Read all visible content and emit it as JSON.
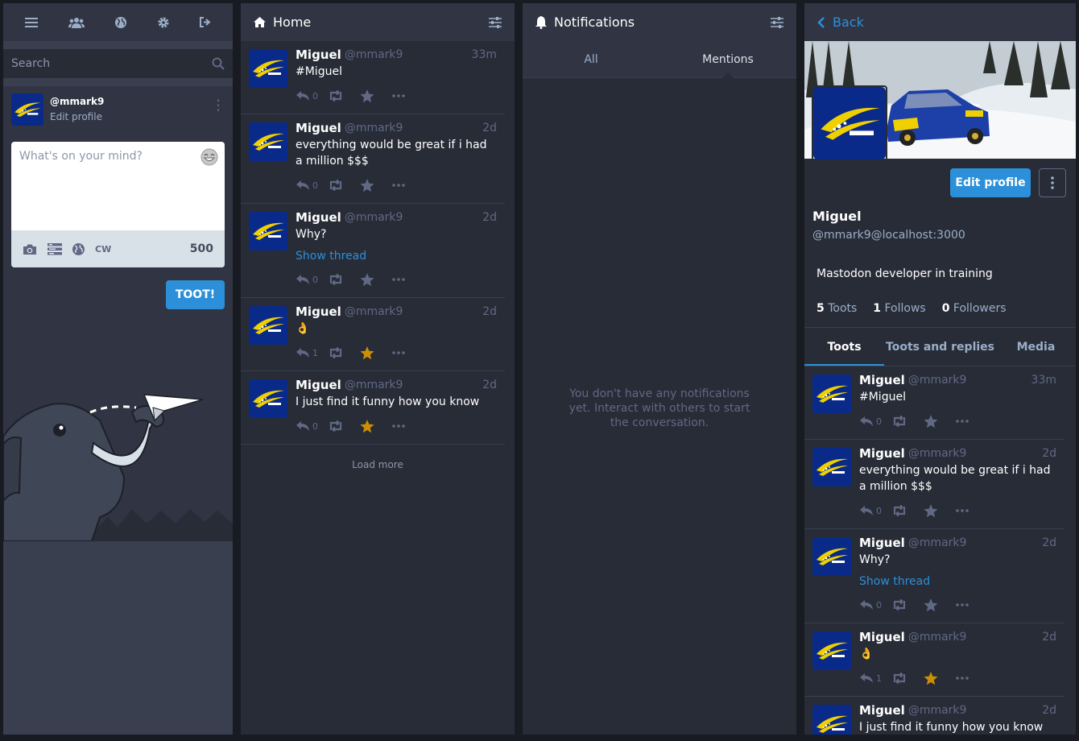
{
  "nav": {
    "icons": [
      "hamburger-icon",
      "people-icon",
      "globe-icon",
      "gear-icon",
      "logout-icon"
    ]
  },
  "search": {
    "placeholder": "Search"
  },
  "account": {
    "acct": "@mmark9",
    "edit_label": "Edit profile"
  },
  "compose": {
    "placeholder": "What's on your mind?",
    "cw_label": "CW",
    "char_count": "500",
    "submit_label": "TOOT!"
  },
  "home": {
    "title": "Home",
    "load_more": "Load more",
    "statuses": [
      {
        "name": "Miguel",
        "handle": "@mmark9",
        "time": "33m",
        "content": "#Miguel",
        "replies": "0",
        "favourited": false
      },
      {
        "name": "Miguel",
        "handle": "@mmark9",
        "time": "2d",
        "content": "everything would be great if i had a million $$$",
        "replies": "0",
        "favourited": false
      },
      {
        "name": "Miguel",
        "handle": "@mmark9",
        "time": "2d",
        "content": "Why?",
        "thread": "Show thread",
        "replies": "0",
        "favourited": false
      },
      {
        "name": "Miguel",
        "handle": "@mmark9",
        "time": "2d",
        "content": "👌",
        "replies": "1",
        "favourited": true
      },
      {
        "name": "Miguel",
        "handle": "@mmark9",
        "time": "2d",
        "content": "I just find it funny how you know",
        "replies": "0",
        "favourited": true
      }
    ]
  },
  "notifications": {
    "title": "Notifications",
    "tabs": [
      "All",
      "Mentions"
    ],
    "empty_text": "You don't have any notifications yet. Interact with others to start the conversation."
  },
  "profile": {
    "back_label": "Back",
    "edit_label": "Edit profile",
    "name": "Miguel",
    "acct": "@mmark9@localhost:3000",
    "bio": "Mastodon developer in training",
    "toots_count": "5",
    "toots_label": "Toots",
    "follows_count": "1",
    "follows_label": "Follows",
    "followers_count": "0",
    "followers_label": "Followers",
    "tabs": [
      "Toots",
      "Toots and replies",
      "Media"
    ]
  },
  "colors": {
    "accent": "#2b90d9",
    "favourite": "#ca8f04",
    "column_bg": "#282c37",
    "header_bg": "#313543"
  }
}
